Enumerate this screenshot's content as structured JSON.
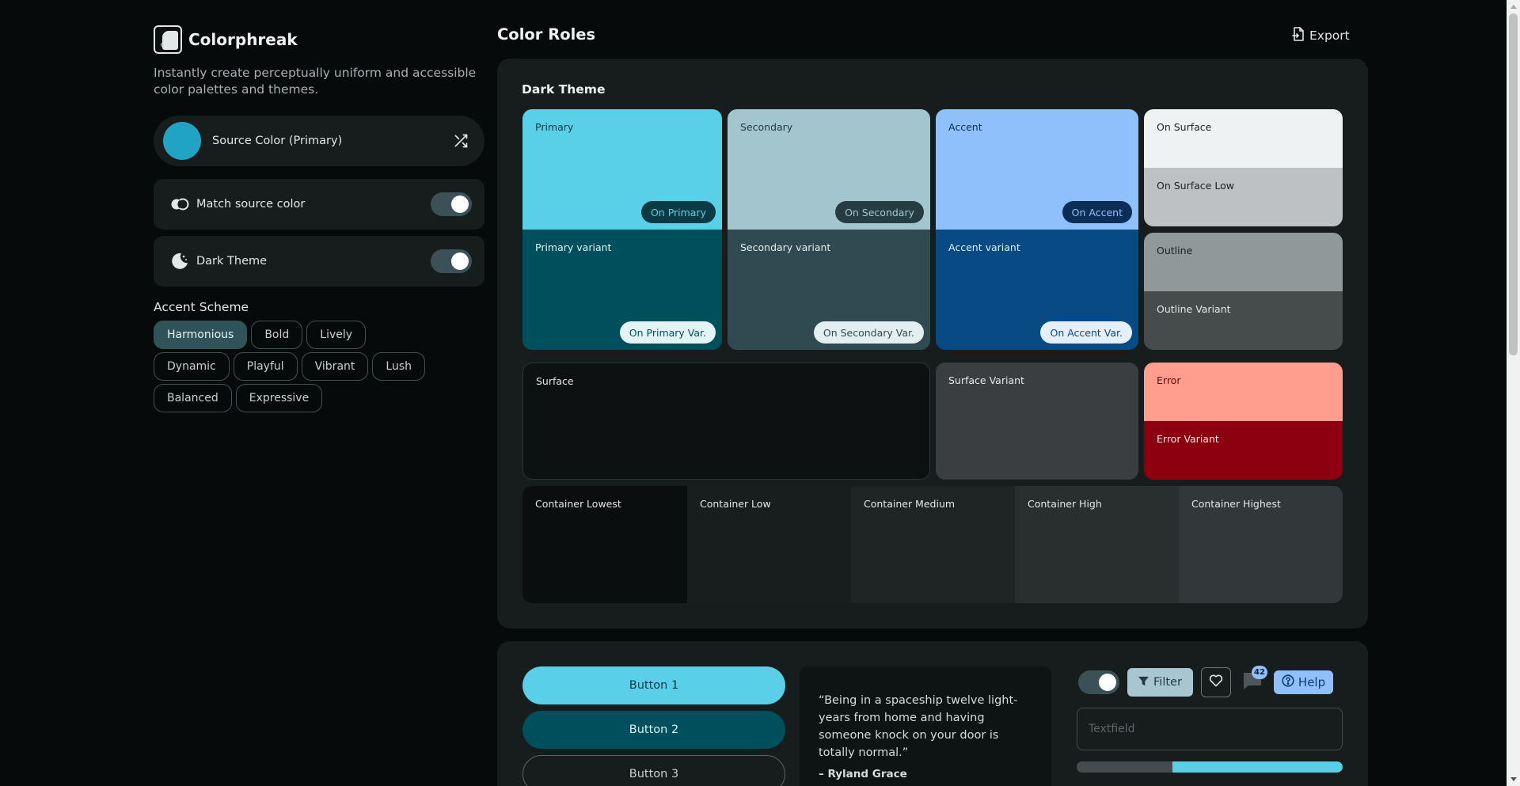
{
  "app": {
    "name": "Colorphreak",
    "tagline": "Instantly create perceptually uniform and accessible color palettes and themes."
  },
  "source": {
    "label": "Source Color (Primary)",
    "color": "#21a4c4",
    "shuffle_icon": "shuffle-icon"
  },
  "settings": {
    "match": {
      "label": "Match source color",
      "on": true,
      "icon": "match-icon"
    },
    "dark": {
      "label": "Dark Theme",
      "on": true,
      "icon": "moon-icon"
    }
  },
  "accent": {
    "title": "Accent Scheme",
    "selected": "Harmonious",
    "options": [
      "Harmonious",
      "Bold",
      "Lively",
      "Dynamic",
      "Playful",
      "Vibrant",
      "Lush",
      "Balanced",
      "Expressive"
    ]
  },
  "main": {
    "title": "Color Roles",
    "export_label": "Export",
    "export_icon": "file-export-icon"
  },
  "roles": {
    "title": "Dark Theme",
    "primary": {
      "label": "Primary",
      "on": "On Primary",
      "bg": "#5ad0e8",
      "fg": "#0a3b44"
    },
    "primary_variant": {
      "label": "Primary variant",
      "on": "On Primary Var.",
      "bg": "#004f5c",
      "fg": "#e3f3f6"
    },
    "secondary": {
      "label": "Secondary",
      "on": "On Secondary",
      "bg": "#a3c5cd",
      "fg": "#253c42"
    },
    "secondary_variant": {
      "label": "Secondary variant",
      "on": "On Secondary Var.",
      "bg": "#2f4a50",
      "fg": "#e3eef0"
    },
    "accent": {
      "label": "Accent",
      "on": "On Accent",
      "bg": "#8fc0fb",
      "fg": "#0b2e57"
    },
    "accent_variant": {
      "label": "Accent variant",
      "on": "On Accent Var.",
      "bg": "#074a84",
      "fg": "#e5effa"
    },
    "on_surface": {
      "label": "On Surface",
      "bg": "#eef2f3",
      "fg": "#1b2123"
    },
    "on_surface_low": {
      "label": "On Surface Low",
      "bg": "#bdc1c3",
      "fg": "#1b2123"
    },
    "outline": {
      "label": "Outline",
      "bg": "#919899",
      "fg": "#1b2123"
    },
    "outline_variant": {
      "label": "Outline Variant",
      "bg": "#464b4c",
      "fg": "#e3e7e8"
    },
    "surface": {
      "label": "Surface",
      "bg": "#0d1112",
      "fg": "#e3e7e8"
    },
    "surface_variant": {
      "label": "Surface Variant",
      "bg": "#3a3e40",
      "fg": "#e3e7e8"
    },
    "error": {
      "label": "Error",
      "bg": "#ff9d8f",
      "fg": "#5c0f0f"
    },
    "error_variant": {
      "label": "Error Variant",
      "bg": "#8c0010",
      "fg": "#ffe5e2"
    },
    "containers": [
      {
        "label": "Container Lowest",
        "bg": "#0a0e0f"
      },
      {
        "label": "Container Low",
        "bg": "#181d1e"
      },
      {
        "label": "Container Medium",
        "bg": "#1f2425"
      },
      {
        "label": "Container High",
        "bg": "#292e2f"
      },
      {
        "label": "Container Highest",
        "bg": "#323739"
      }
    ]
  },
  "preview": {
    "button1": "Button 1",
    "button2": "Button 2",
    "button3": "Button 3",
    "quote": "“Being in a spaceship twelve light-years from home and having someone knock on your door is totally normal.”",
    "quote_author": "– Ryland Grace",
    "filter_label": "Filter",
    "badge_count": "42",
    "help_label": "Help",
    "textfield_placeholder": "Textfield",
    "progress": 0.64,
    "toggle_on": true
  }
}
